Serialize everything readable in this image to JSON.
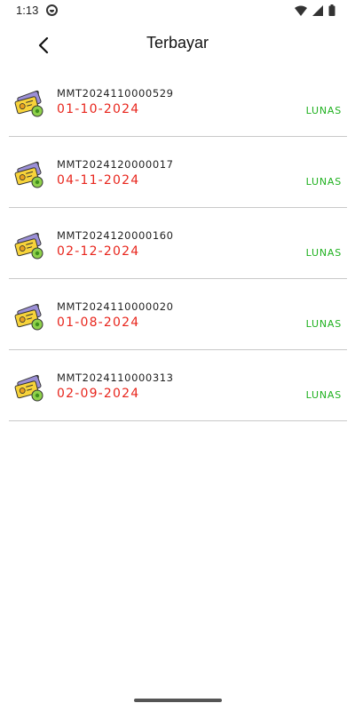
{
  "status_bar": {
    "time": "1:13"
  },
  "header": {
    "title": "Terbayar"
  },
  "colors": {
    "date": "#e8261d",
    "status": "#1fb11f"
  },
  "items": [
    {
      "id": "MMT2024110000529",
      "date": "01-10-2024",
      "status": "LUNAS"
    },
    {
      "id": "MMT2024120000017",
      "date": "04-11-2024",
      "status": "LUNAS"
    },
    {
      "id": "MMT2024120000160",
      "date": "02-12-2024",
      "status": "LUNAS"
    },
    {
      "id": "MMT2024110000020",
      "date": "01-08-2024",
      "status": "LUNAS"
    },
    {
      "id": "MMT2024110000313",
      "date": "02-09-2024",
      "status": "LUNAS"
    }
  ]
}
